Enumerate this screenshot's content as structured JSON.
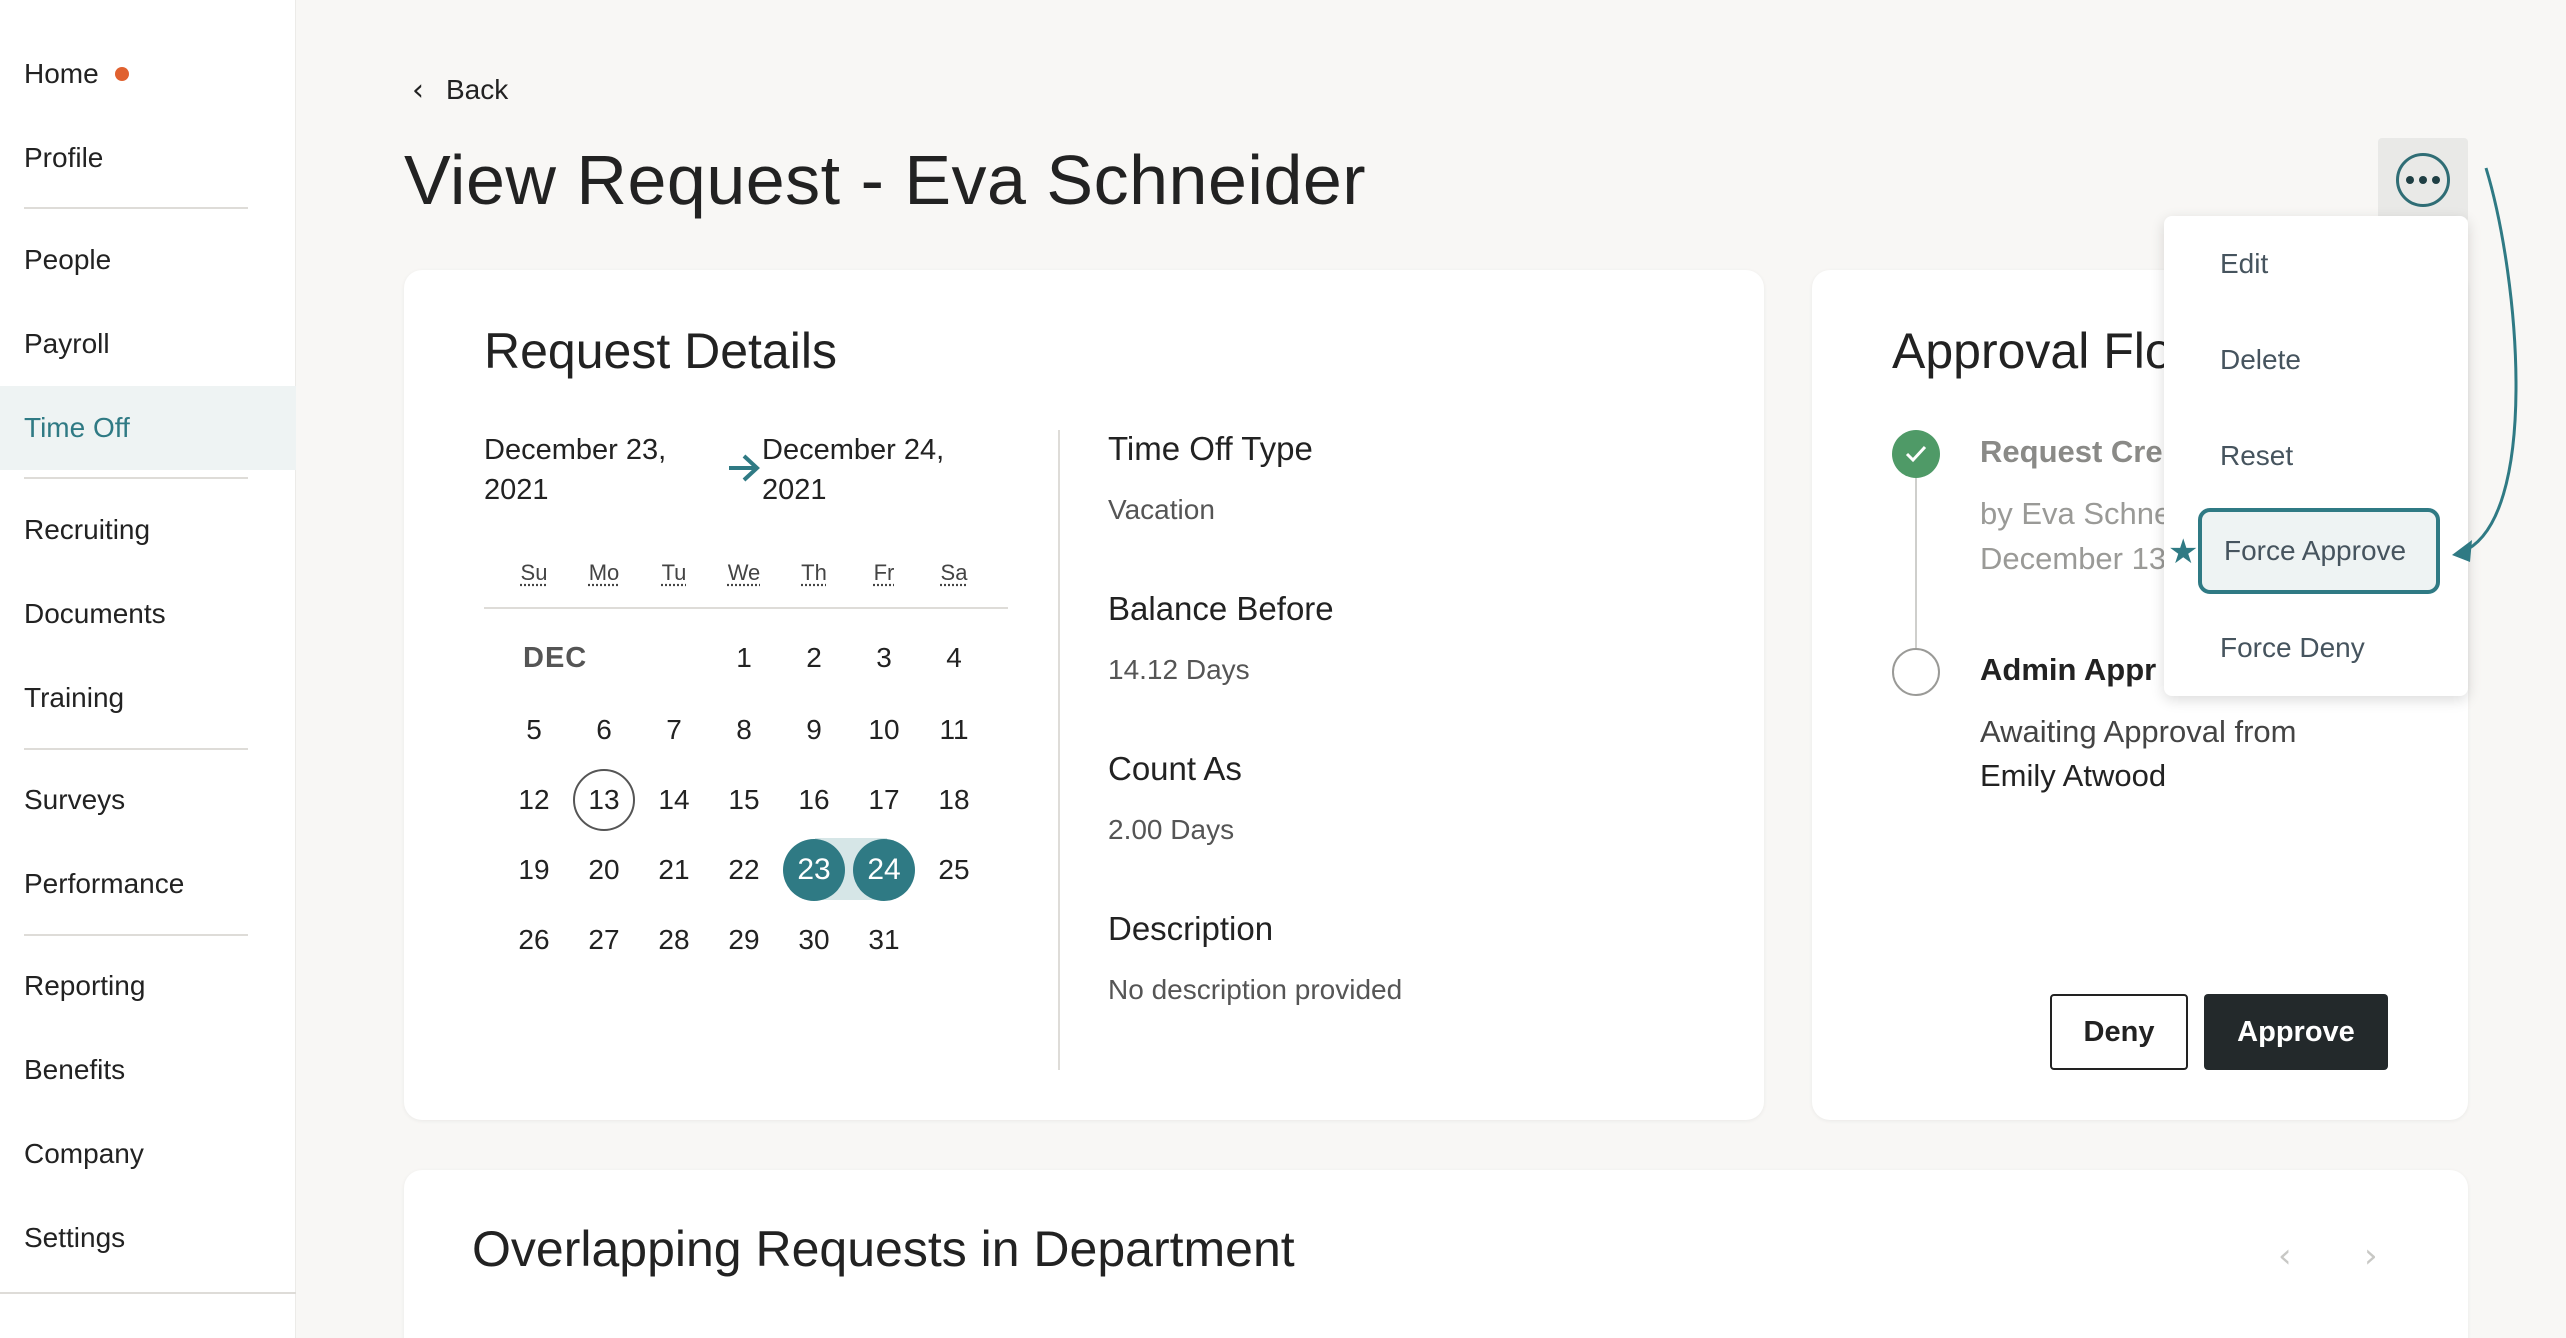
{
  "sidebar": {
    "items": [
      {
        "label": "Home"
      },
      {
        "label": "Profile"
      },
      {
        "label": "People"
      },
      {
        "label": "Payroll"
      },
      {
        "label": "Time Off"
      },
      {
        "label": "Recruiting"
      },
      {
        "label": "Documents"
      },
      {
        "label": "Training"
      },
      {
        "label": "Surveys"
      },
      {
        "label": "Performance"
      },
      {
        "label": "Reporting"
      },
      {
        "label": "Benefits"
      },
      {
        "label": "Company"
      },
      {
        "label": "Settings"
      }
    ],
    "active": "Time Off",
    "notification_color": "#e0612f"
  },
  "header": {
    "back_label": "Back",
    "title": "View Request - Eva Schneider"
  },
  "request_details": {
    "title": "Request Details",
    "start_date_line1": "December 23,",
    "start_date_line2": "2021",
    "end_date_line1": "December 24,",
    "end_date_line2": "2021",
    "calendar": {
      "weekdays": [
        "Su",
        "Mo",
        "Tu",
        "We",
        "Th",
        "Fr",
        "Sa"
      ],
      "month_label": "DEC",
      "first_weekday_index": 3,
      "days_in_month": 31,
      "today": 13,
      "selected": [
        23,
        24
      ]
    },
    "fields": {
      "type_label": "Time Off Type",
      "type_value": "Vacation",
      "balance_label": "Balance Before",
      "balance_value": "14.12 Days",
      "count_label": "Count As",
      "count_value": "2.00 Days",
      "description_label": "Description",
      "description_value": "No description provided"
    }
  },
  "approval_flow": {
    "title": "Approval Flo",
    "step1_title": "Request Cre",
    "step1_by": "by Eva Schne",
    "step1_date": "December 13",
    "step2_title": "Admin Appr",
    "step2_line1": "Awaiting Approval from",
    "step2_line2": "Emily Atwood",
    "deny_label": "Deny",
    "approve_label": "Approve"
  },
  "menu": {
    "items": [
      {
        "label": "Edit"
      },
      {
        "label": "Delete"
      },
      {
        "label": "Reset"
      },
      {
        "label": "Force Approve"
      },
      {
        "label": "Force Deny"
      }
    ],
    "highlighted": "Force Approve"
  },
  "overlapping": {
    "title": "Overlapping Requests in Department",
    "prev_icon": "chevron-left-icon",
    "next_icon": "chevron-right-icon"
  },
  "colors": {
    "accent": "#2f7a84",
    "success": "#4f9a67",
    "dark_button": "#23292b"
  }
}
